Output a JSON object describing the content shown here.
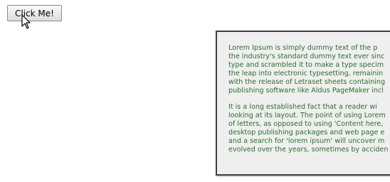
{
  "button": {
    "label": "Click Me!"
  },
  "cursor": {
    "icon": "arrow-pointer-icon"
  },
  "panel": {
    "paragraphs": [
      {
        "lines": [
          "Lorem Ipsum is simply dummy text of the p",
          "the industry's standard dummy text ever sinc",
          "type and scrambled it to make a type specim",
          "the leap into electronic typesetting, remainin",
          "with the release of Letraset sheets containing",
          "publishing software like Aldus PageMaker incl"
        ]
      },
      {
        "lines": [
          "It is a long established fact that a reader wi",
          "looking at its layout. The point of using Lorem",
          "of letters, as opposed to using 'Content here,",
          "desktop publishing packages and web page e",
          "and a search for 'lorem ipsum' will uncover m",
          "evolved over the years, sometimes by acciden"
        ]
      }
    ]
  },
  "colors": {
    "text": "#2c6e2c",
    "panel_background": "#efefef",
    "panel_border": "#404040"
  }
}
